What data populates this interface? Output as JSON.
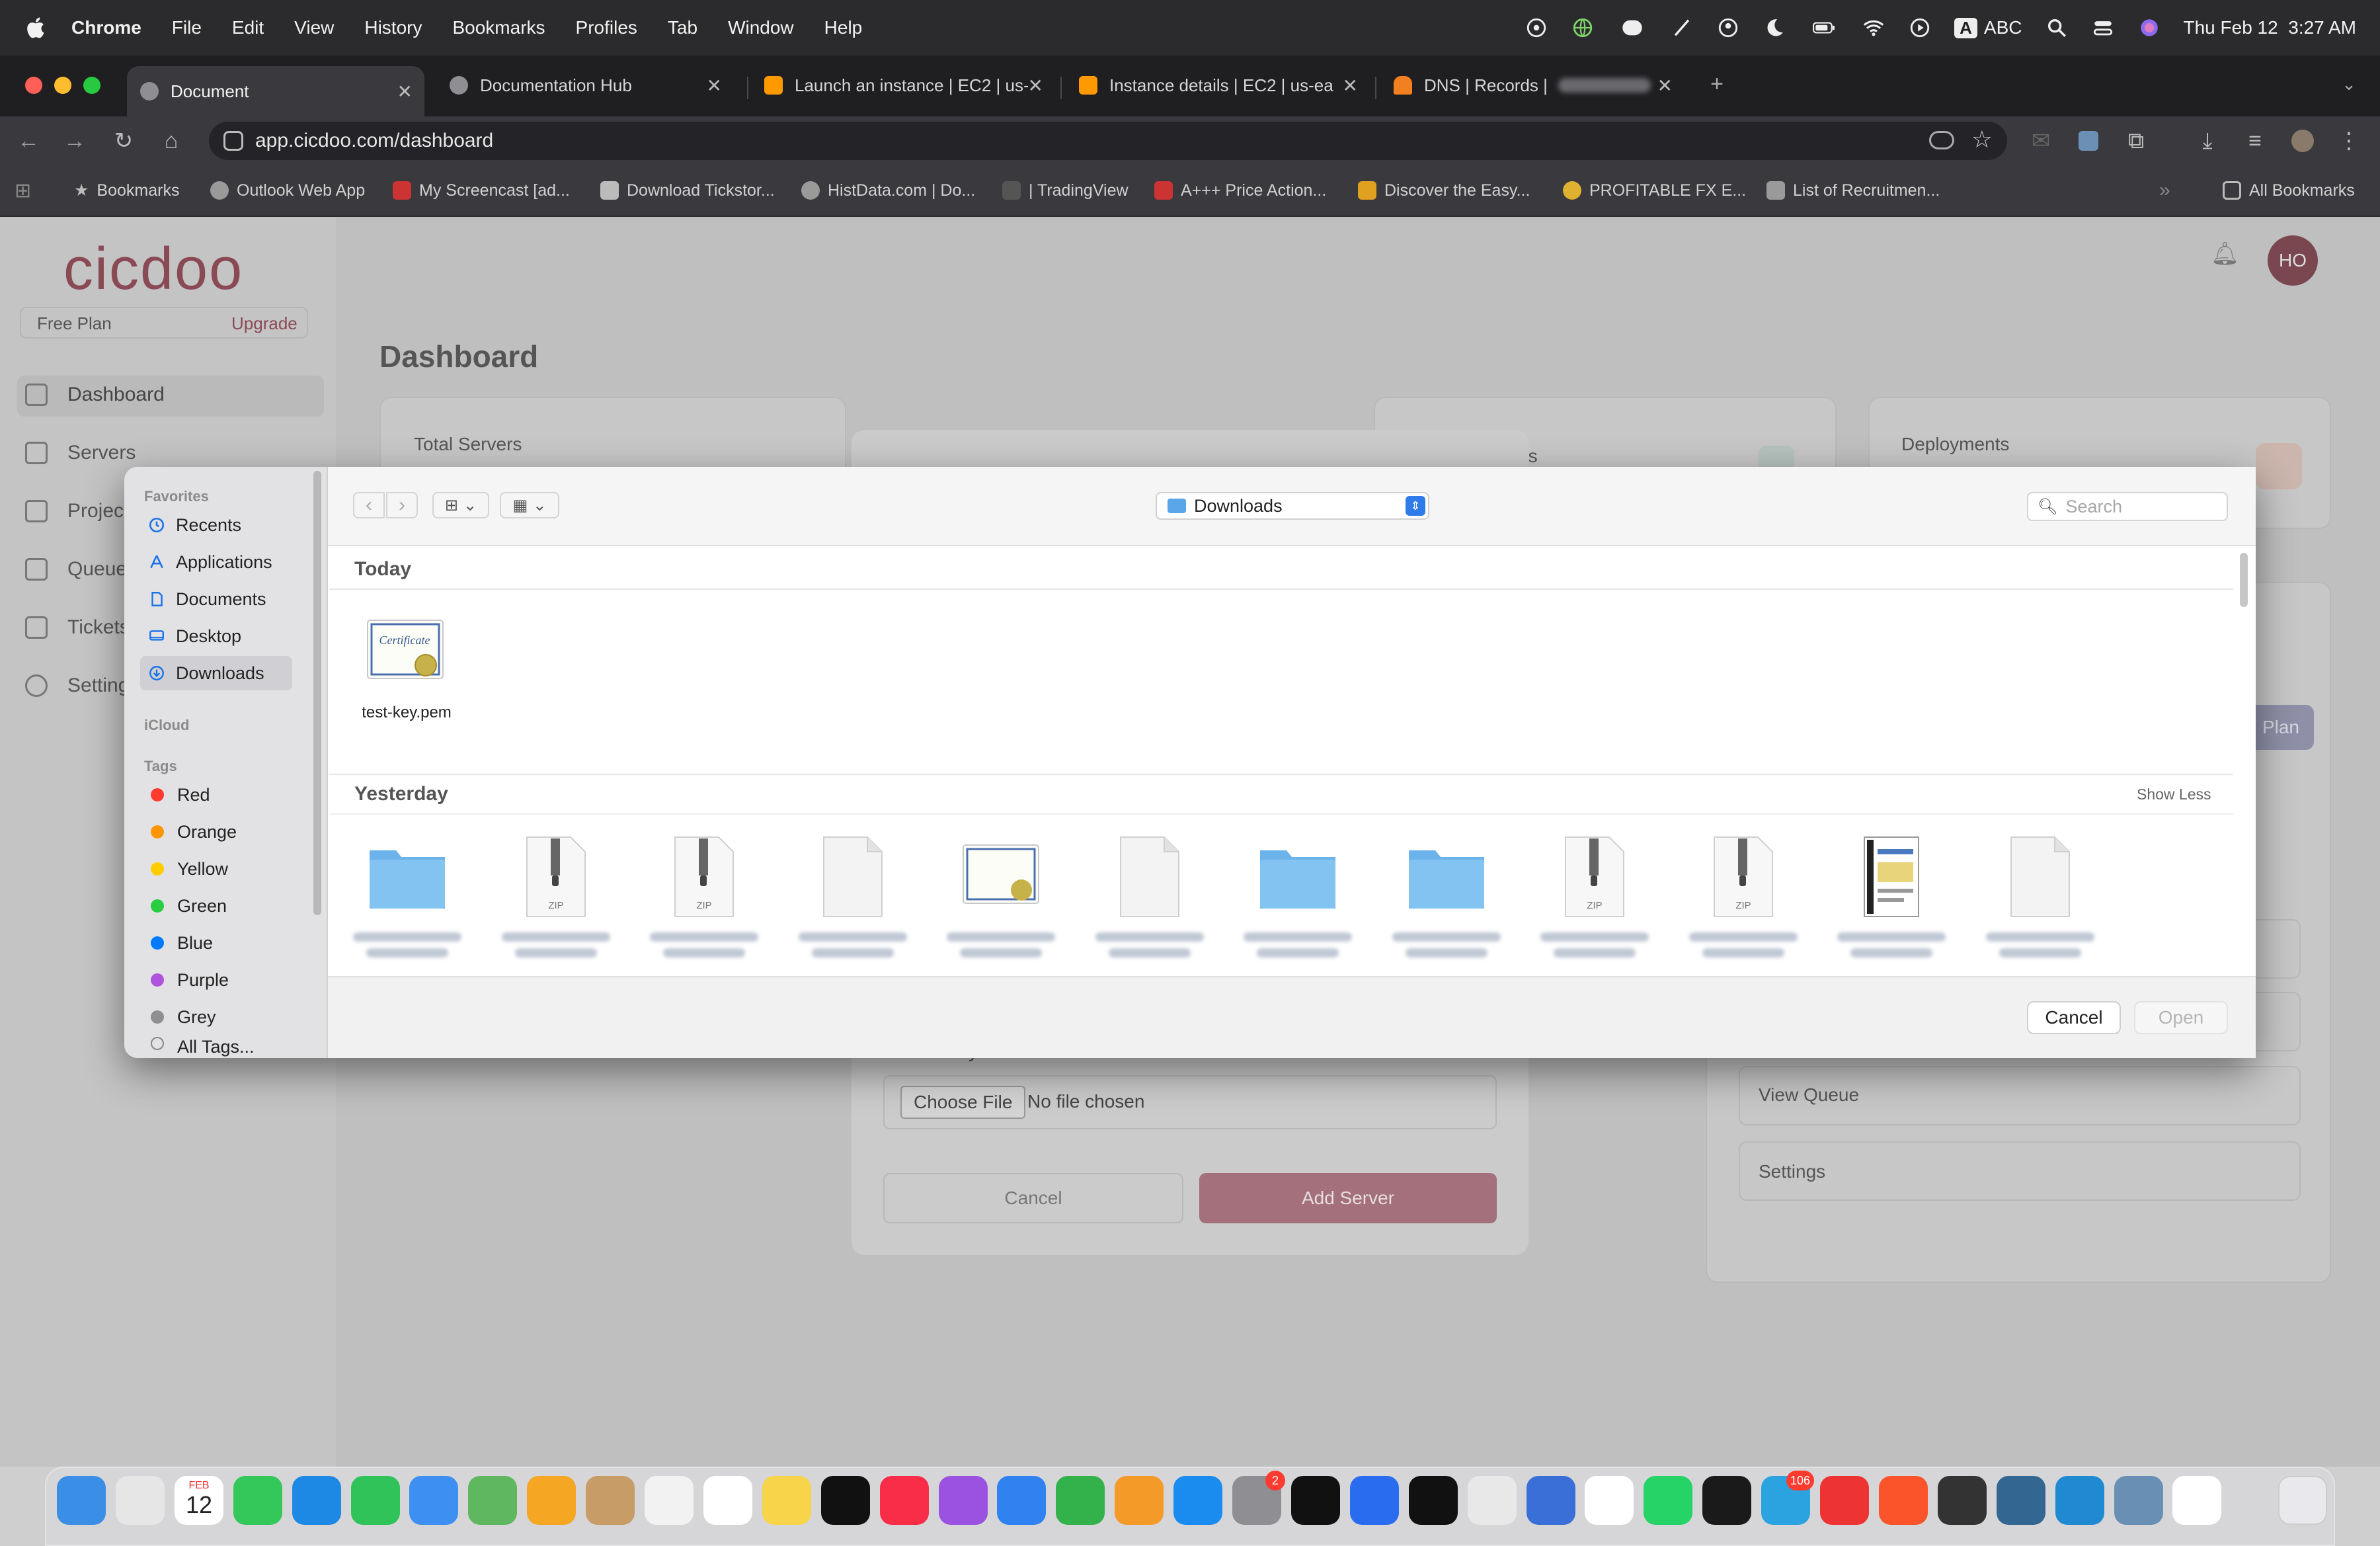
{
  "menubar": {
    "items": [
      "Chrome",
      "File",
      "Edit",
      "View",
      "History",
      "Bookmarks",
      "Profiles",
      "Tab",
      "Window",
      "Help"
    ],
    "input_source": "ABC",
    "input_badge": "A",
    "clock": "Thu Feb 12  3:27 AM",
    "notif_badge": "106"
  },
  "tabs": [
    {
      "label": "Document",
      "color": "#8e8e93"
    },
    {
      "label": "Documentation Hub",
      "color": "#8e8e93"
    },
    {
      "label": "Launch an instance | EC2 | us-e",
      "color": "#ff9900"
    },
    {
      "label": "Instance details | EC2 | us-ea",
      "color": "#ff9900"
    },
    {
      "label": "DNS | Records | ",
      "color": "#f38020"
    }
  ],
  "address": {
    "url": "app.cicdoo.com/dashboard"
  },
  "bookmarks": {
    "items": [
      {
        "label": "Bookmarks",
        "color": "#9a9a9a"
      },
      {
        "label": "Outlook Web App",
        "color": "#9a9a9a"
      },
      {
        "label": "My Screencast [ad...",
        "color": "#cc3333"
      },
      {
        "label": "Download Tickstor...",
        "color": "#bbbbbb"
      },
      {
        "label": "HistData.com | Do...",
        "color": "#9a9a9a"
      },
      {
        "label": "| TradingView",
        "color": "#555555"
      },
      {
        "label": "A+++ Price Action...",
        "color": "#cc3333"
      },
      {
        "label": "Discover the Easy...",
        "color": "#e0a020"
      },
      {
        "label": "PROFITABLE FX E...",
        "color": "#e0b030"
      },
      {
        "label": "List of Recruitmen...",
        "color": "#9a9a9a"
      }
    ],
    "all": "All Bookmarks"
  },
  "app": {
    "logo": "cicdoo",
    "plan": "Free Plan",
    "upgrade": "Upgrade",
    "nav": [
      "Dashboard",
      "Servers",
      "Projects",
      "Queues",
      "Tickets",
      "Settings"
    ],
    "page_title": "Dashboard",
    "cards": {
      "total_servers": "Total Servers",
      "services": "es",
      "deployments": "Deployments"
    },
    "plan_button": "Plan",
    "avatar": "HO",
    "quick": {
      "view_queue": "View Queue",
      "settings": "Settings"
    }
  },
  "modal": {
    "private_key_label": "Private Key",
    "choose_file": "Choose File",
    "no_file": "No file chosen",
    "cancel": "Cancel",
    "add_server": "Add Server"
  },
  "picker": {
    "favorites_header": "Favorites",
    "favorites": [
      "Recents",
      "Applications",
      "Documents",
      "Desktop",
      "Downloads"
    ],
    "icloud_header": "iCloud",
    "tags_header": "Tags",
    "tags": [
      {
        "label": "Red",
        "color": "#ff3b30"
      },
      {
        "label": "Orange",
        "color": "#ff9500"
      },
      {
        "label": "Yellow",
        "color": "#ffcc00"
      },
      {
        "label": "Green",
        "color": "#28cd41"
      },
      {
        "label": "Blue",
        "color": "#007aff"
      },
      {
        "label": "Purple",
        "color": "#af52de"
      },
      {
        "label": "Grey",
        "color": "#8e8e93"
      }
    ],
    "all_tags": "All Tags...",
    "location": "Downloads",
    "search_placeholder": "Search",
    "today": "Today",
    "today_file": "test-key.pem",
    "yesterday": "Yesterday",
    "show_less": "Show Less",
    "yesterday_kinds": [
      "folder",
      "zip",
      "zip",
      "doc",
      "cert",
      "doc",
      "folder",
      "folder",
      "zip",
      "zip",
      "pdf",
      "doc"
    ],
    "zip_label": "ZIP",
    "cancel": "Cancel",
    "open": "Open"
  },
  "dock": {
    "calendar_month": "FEB",
    "calendar_day": "12",
    "settings_badge": "2",
    "telegram_badge": "106"
  }
}
